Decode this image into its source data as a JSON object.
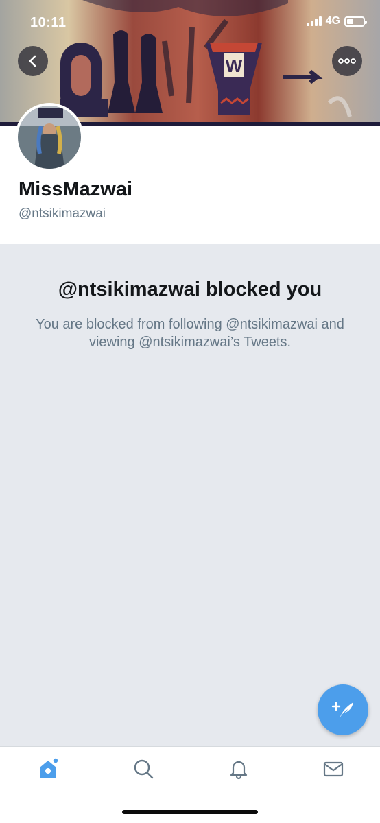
{
  "status_bar": {
    "time": "10:11",
    "network": "4G"
  },
  "header": {
    "banner_text": "QHAWE",
    "back_icon": "chevron-left-icon",
    "more_icon": "more-horizontal-icon"
  },
  "profile": {
    "display_name": "MissMazwai",
    "handle": "@ntsikimazwai"
  },
  "blocked": {
    "title": "@ntsikimazwai blocked you",
    "message": "You are blocked from following @ntsikimazwai and viewing @ntsikimazwai’s Tweets."
  },
  "fab": {
    "icon": "compose-tweet-icon"
  },
  "tabbar": {
    "items": [
      {
        "icon": "home-icon",
        "active": true
      },
      {
        "icon": "search-icon",
        "active": false
      },
      {
        "icon": "bell-icon",
        "active": false
      },
      {
        "icon": "mail-icon",
        "active": false
      }
    ]
  },
  "colors": {
    "accent": "#4c9eeb",
    "text_primary": "#14171a",
    "text_secondary": "#657786",
    "background": "#e6e9ee"
  }
}
